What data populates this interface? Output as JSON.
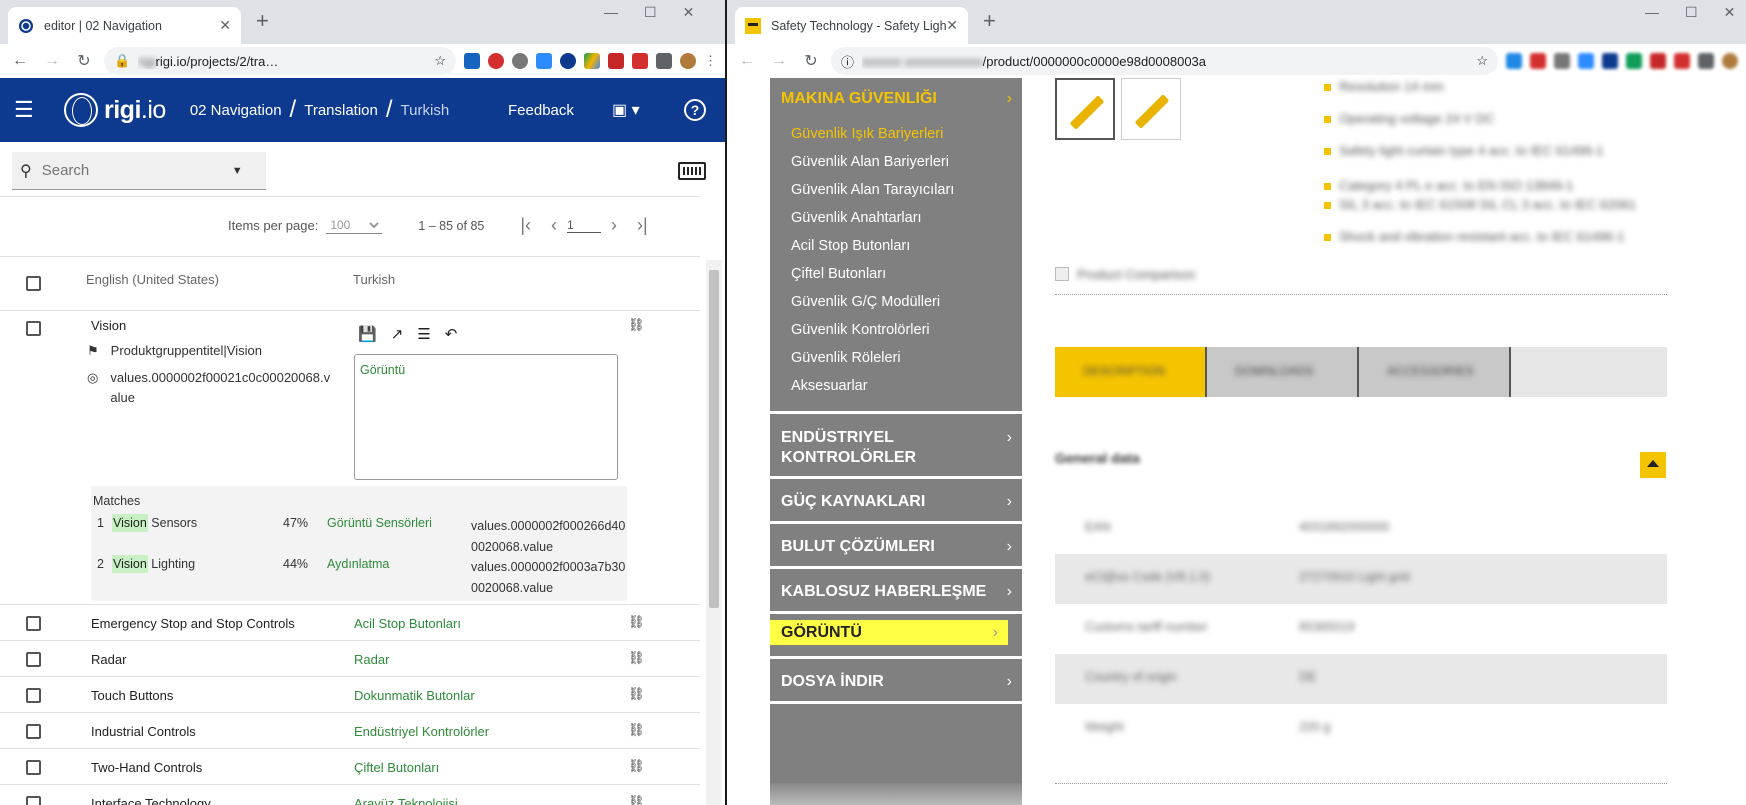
{
  "left_window": {
    "tab_title": "editor | 02 Navigation",
    "url_blurred": "rigi",
    "url_visible": "rigi.io/projects/2/tra…",
    "app": {
      "logo_text": "rigi.io",
      "breadcrumb": [
        "02 Navigation",
        "Translation",
        "Turkish"
      ],
      "feedback_label": "Feedback",
      "help_label": "?"
    },
    "search": {
      "placeholder": "Search"
    },
    "pager": {
      "items_per_page_label": "Items per page:",
      "items_per_page_value": "100",
      "range": "1 – 85 of 85",
      "page": "1"
    },
    "columns": {
      "source": "English (United States)",
      "target": "Turkish"
    },
    "expanded_row": {
      "source": "Vision",
      "context": "Produktgruppentitel|Vision",
      "key": "values.0000002f00021c0c00020068.value",
      "translation": "Görüntü",
      "matches_label": "Matches",
      "matches": [
        {
          "n": "1",
          "hl": "Vision",
          "rest": " Sensors",
          "pct": "47%",
          "target": "Görüntü Sensörleri",
          "key": "values.0000002f000266d400020068.value"
        },
        {
          "n": "2",
          "hl": "Vision",
          "rest": " Lighting",
          "pct": "44%",
          "target": "Aydınlatma",
          "key": "values.0000002f0003a7b300020068.value"
        }
      ]
    },
    "rows": [
      {
        "source": "Emergency Stop and Stop Controls",
        "target": "Acil Stop Butonları"
      },
      {
        "source": "Radar",
        "target": "Radar"
      },
      {
        "source": "Touch Buttons",
        "target": "Dokunmatik Butonlar"
      },
      {
        "source": "Industrial Controls",
        "target": "Endüstriyel Kontrolörler"
      },
      {
        "source": "Two-Hand Controls",
        "target": "Çiftel Butonları"
      },
      {
        "source": "Interface Technology",
        "target": "Arayüz Teknolojisi"
      }
    ]
  },
  "right_window": {
    "tab_title": "Safety Technology - Safety Light",
    "url_visible": "/product/0000000c0000e98d0008003a",
    "sidebar": {
      "section1": "MAKINA GÜVENLIĞI",
      "items": [
        "Güvenlik Işık Bariyerleri",
        "Güvenlik Alan Bariyerleri",
        "Güvenlik Alan Tarayıcıları",
        "Güvenlik Anahtarları",
        "Acil Stop Butonları",
        "Çiftel Butonları",
        "Güvenlik G/Ç Modülleri",
        "Güvenlik Kontrolörleri",
        "Güvenlik Röleleri",
        "Aksesuarlar"
      ],
      "sections": [
        {
          "label": "ENDÜSTRIYEL KONTROLÖRLER"
        },
        {
          "label": "GÜÇ KAYNAKLARI"
        },
        {
          "label": "BULUT ÇÖZÜMLERI"
        },
        {
          "label": "KABLOSUZ HABERLEŞME"
        },
        {
          "label": "GÖRÜNTÜ"
        },
        {
          "label": "DOSYA İNDIR"
        }
      ]
    }
  },
  "colors": {
    "rigi_blue": "#0d3a8e",
    "translation_green": "#2e8b3a",
    "accent_yellow": "#f5c400",
    "highlight_yellow": "#ffff44",
    "sidebar_gray": "#808080"
  }
}
